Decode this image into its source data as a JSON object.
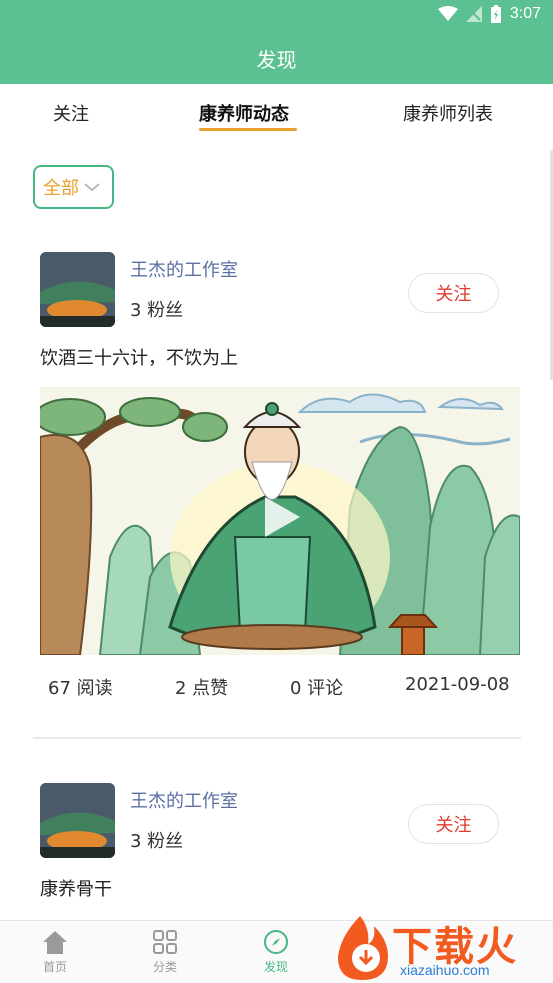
{
  "status_bar": {
    "time": "3:07",
    "bg_color": "#5bc192"
  },
  "app_bar": {
    "title": "发现"
  },
  "tabs": [
    {
      "label": "关注",
      "active": false
    },
    {
      "label": "康养师动态",
      "active": true
    },
    {
      "label": "康养师列表",
      "active": false
    }
  ],
  "filter": {
    "label": "全部",
    "icon": "chevron-down-icon"
  },
  "posts": [
    {
      "author": "王杰的工作室",
      "fans": "3 粉丝",
      "follow_label": "关注",
      "title": "饮酒三十六计，不饮为上",
      "has_video": true,
      "stats": {
        "reads": "67 阅读",
        "likes": "2 点赞",
        "comments": "0 评论",
        "date": "2021-09-08"
      }
    },
    {
      "author": "王杰的工作室",
      "fans": "3 粉丝",
      "follow_label": "关注",
      "title": "康养骨干"
    }
  ],
  "bottom_nav": [
    {
      "label": "首页",
      "icon": "home-icon",
      "active": false
    },
    {
      "label": "分类",
      "icon": "grid-icon",
      "active": false
    },
    {
      "label": "发现",
      "icon": "compass-icon",
      "active": true
    }
  ],
  "watermark": {
    "text": "下载火",
    "url": "xiazaihuo.com"
  },
  "colors": {
    "accent": "#5bc192",
    "tab_indicator": "#e8a12c",
    "follow": "#e23b2f",
    "author": "#5d6fa3"
  }
}
